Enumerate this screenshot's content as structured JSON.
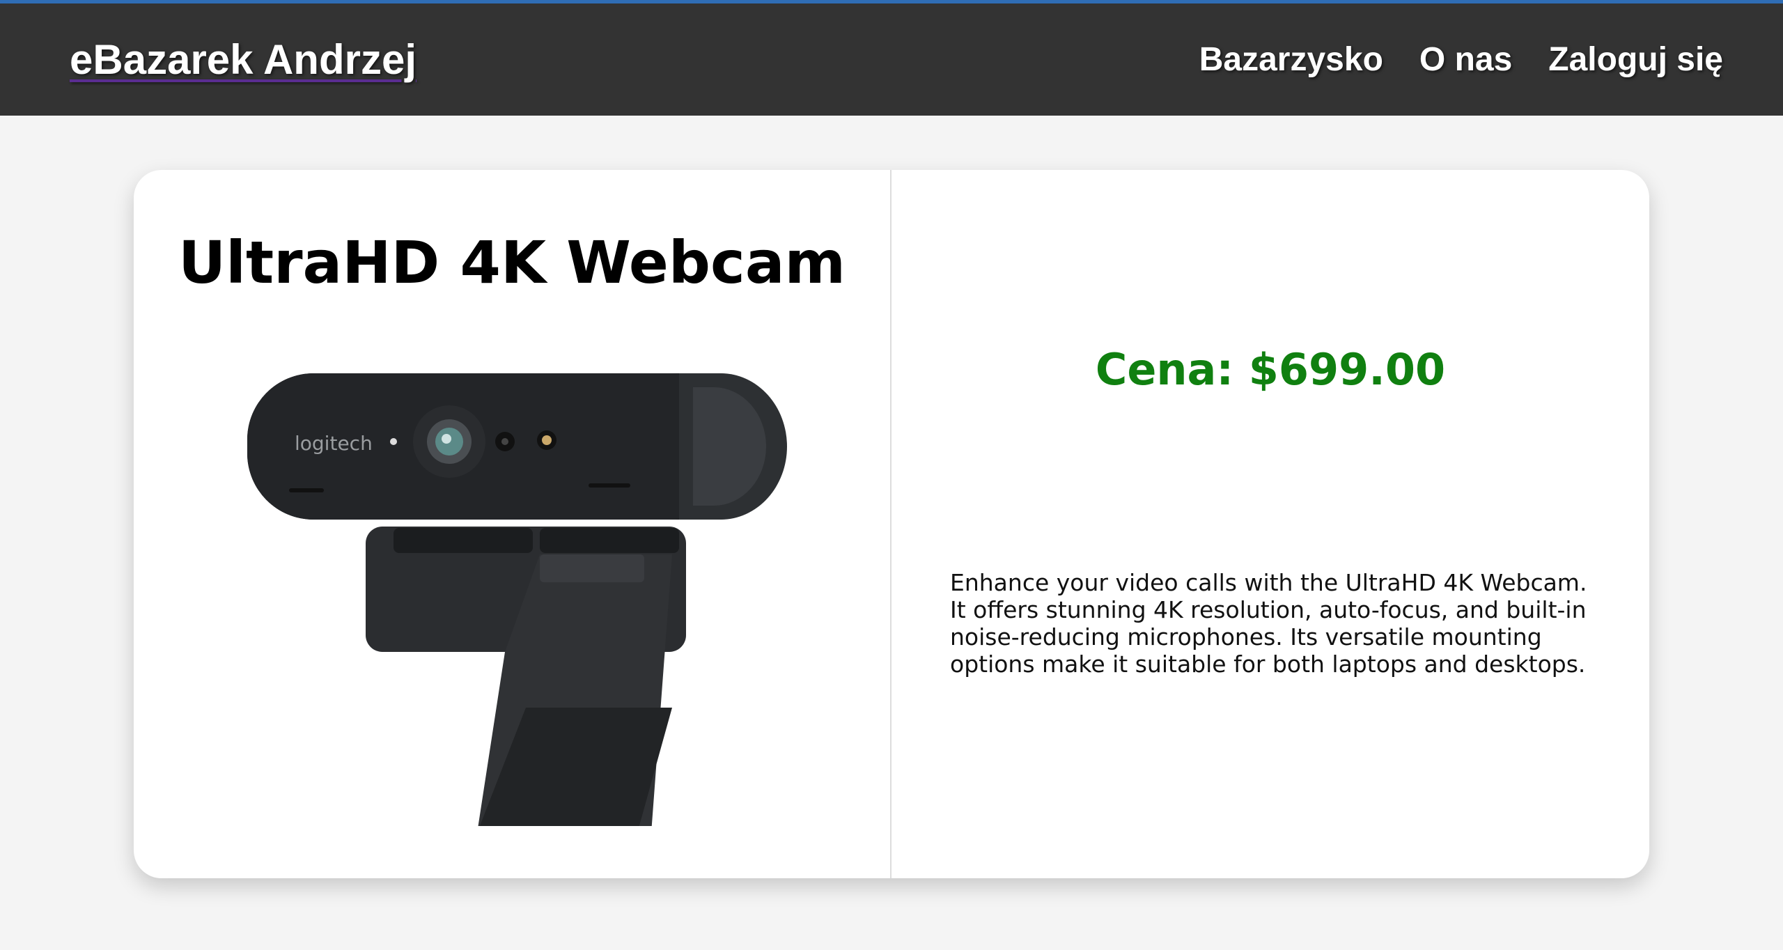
{
  "header": {
    "brand": "eBazarek Andrzej",
    "nav": [
      "Bazarzysko",
      "O nas",
      "Zaloguj się"
    ]
  },
  "product": {
    "title": "UltraHD 4K Webcam",
    "price": "Cena: $699.00",
    "description": "Enhance your video calls with the UltraHD 4K Webcam. It offers stunning 4K resolution, auto-focus, and built-in noise-reducing microphones. Its versatile mounting options make it suitable for both laptops and desktops.",
    "image_brand_text": "logitech"
  },
  "colors": {
    "navbar": "#333333",
    "accent_line": "#2f6db5",
    "price": "#108010",
    "background": "#f4f4f4"
  }
}
